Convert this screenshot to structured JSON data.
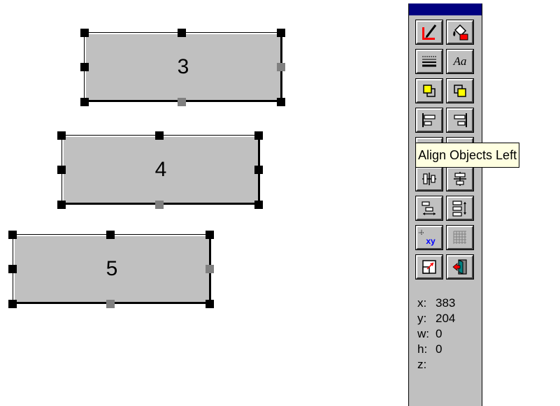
{
  "canvas": {
    "objects": [
      {
        "label": "3"
      },
      {
        "label": "4"
      },
      {
        "label": "5"
      }
    ]
  },
  "toolbox": {
    "buttons": [
      {
        "icon": "paintbrush-icon"
      },
      {
        "icon": "paint-bucket-icon"
      },
      {
        "icon": "line-style-icon"
      },
      {
        "icon": "font-icon",
        "glyph": "Aa"
      },
      {
        "icon": "bring-to-front-icon"
      },
      {
        "icon": "send-to-back-icon"
      },
      {
        "icon": "align-left-icon"
      },
      {
        "icon": "align-right-icon"
      },
      {
        "icon": "align-top-icon"
      },
      {
        "icon": "align-bottom-icon"
      },
      {
        "icon": "center-horizontal-icon"
      },
      {
        "icon": "center-vertical-icon"
      },
      {
        "icon": "space-horizontal-icon"
      },
      {
        "icon": "space-vertical-icon"
      },
      {
        "icon": "coordinates-icon",
        "glyph": "xy"
      },
      {
        "icon": "grid-icon"
      },
      {
        "icon": "resize-icon"
      },
      {
        "icon": "exit-icon"
      }
    ],
    "coords": [
      {
        "label": "x:",
        "value": "383"
      },
      {
        "label": "y:",
        "value": "204"
      },
      {
        "label": "w:",
        "value": "0"
      },
      {
        "label": "h:",
        "value": "0"
      },
      {
        "label": "z:",
        "value": ""
      }
    ]
  },
  "tooltip": {
    "text": "Align Objects Left"
  },
  "colors": {
    "title_bar": "#000080",
    "face": "#c0c0c0",
    "tooltip_bg": "#ffffe1",
    "paint_red": "#ff0000",
    "xy_blue": "#0000ff"
  }
}
